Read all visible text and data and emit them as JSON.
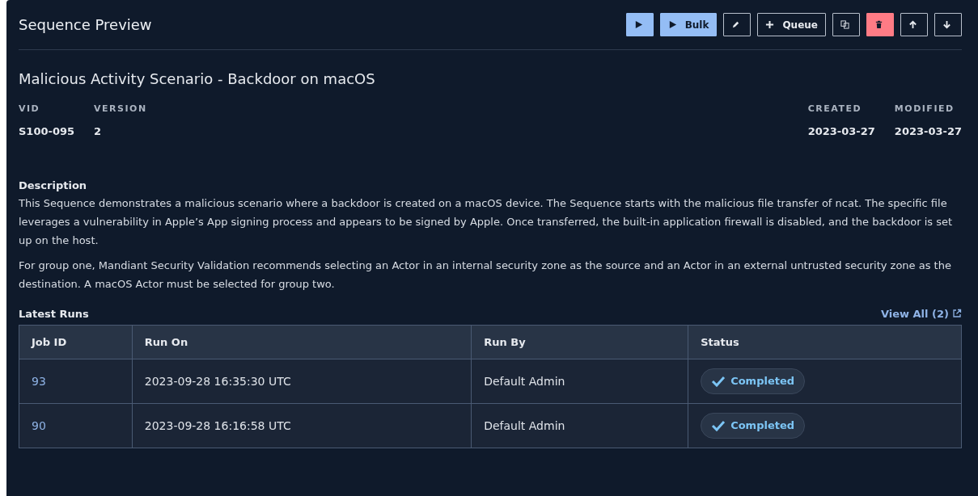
{
  "panel": {
    "title": "Sequence Preview"
  },
  "toolbar": [
    {
      "kind": "primary"
    },
    {
      "kind": "primary",
      "label": "Bulk"
    },
    {
      "kind": "outline"
    },
    {
      "kind": "outline",
      "label": "Queue"
    },
    {
      "kind": "outline"
    },
    {
      "kind": "danger"
    },
    {
      "kind": "outline"
    },
    {
      "kind": "outline"
    }
  ],
  "sequence": {
    "name": "Malicious Activity Scenario - Backdoor on macOS",
    "fields_left": [
      {
        "label": "VID",
        "value": "S100-095"
      },
      {
        "label": "VERSION",
        "value": "2"
      }
    ],
    "fields_right": [
      {
        "label": "CREATED",
        "value": "2023-03-27"
      },
      {
        "label": "MODIFIED",
        "value": "2023-03-27"
      }
    ]
  },
  "description": {
    "heading": "Description",
    "paragraphs": [
      "This Sequence demonstrates a malicious scenario where a backdoor is created on a macOS device. The Sequence starts with the malicious file transfer of ncat. The specific file leverages a vulnerability in Apple’s App signing process and appears to be signed by Apple. Once transferred, the built-in application firewall is disabled, and the backdoor is set up on the host.",
      "For group one, Mandiant Security Validation recommends selecting an Actor in an internal security zone as the source and an Actor in an external untrusted security zone as the destination. A macOS Actor must be selected for group two."
    ]
  },
  "latest_runs": {
    "heading": "Latest Runs",
    "view_all": "View All (2)",
    "table": {
      "columns": [
        "Job ID",
        "Run On",
        "Run By",
        "Status"
      ],
      "rows": [
        {
          "job_id": "93",
          "run_on": "2023-09-28 16:35:30 UTC",
          "run_by": "Default Admin",
          "status": "Completed"
        },
        {
          "job_id": "90",
          "run_on": "2023-09-28 16:16:58 UTC",
          "run_by": "Default Admin",
          "status": "Completed"
        }
      ]
    }
  }
}
